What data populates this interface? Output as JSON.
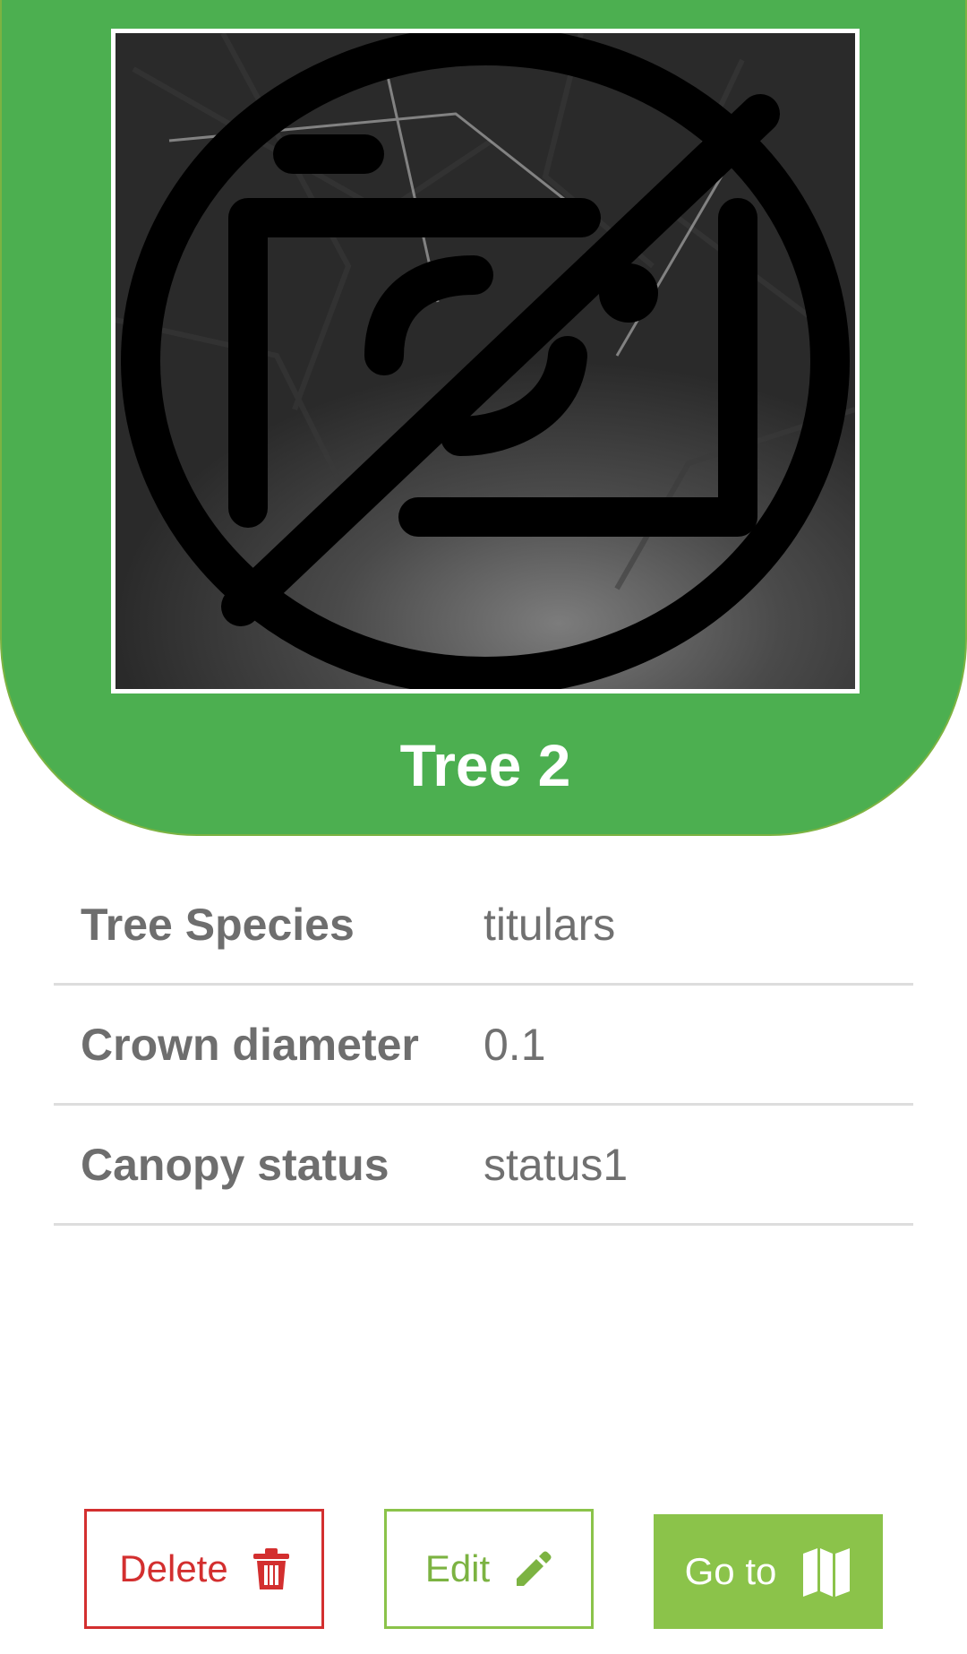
{
  "header": {
    "title": "Tree 2",
    "image_placeholder_icon": "no-photo-icon",
    "colors": {
      "background": "#4caf50",
      "border": "#7cb342",
      "title": "#ffffff"
    }
  },
  "details": [
    {
      "label": "Tree Species",
      "value": "titulars"
    },
    {
      "label": "Crown diameter",
      "value": "0.1"
    },
    {
      "label": "Canopy status",
      "value": "status1"
    }
  ],
  "actions": {
    "delete": {
      "label": "Delete",
      "icon": "trash-icon",
      "color": "#d32f2f"
    },
    "edit": {
      "label": "Edit",
      "icon": "pencil-icon",
      "color": "#8bc34a"
    },
    "goto": {
      "label": "Go to",
      "icon": "map-icon",
      "color": "#8bc34a"
    }
  }
}
